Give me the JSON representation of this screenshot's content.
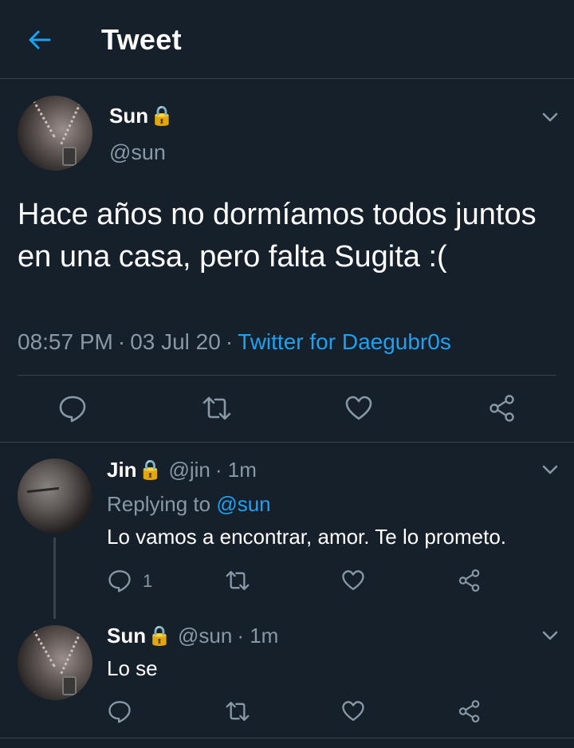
{
  "header": {
    "title": "Tweet"
  },
  "main_tweet": {
    "name": "Sun",
    "lock": "🔒",
    "handle": "@sun",
    "text": "Hace años no dormíamos todos juntos en una casa, pero falta Sugita :(",
    "time": "08:57 PM",
    "date": "03 Jul 20",
    "separator": "·",
    "source": "Twitter for Daegubr0s"
  },
  "replies": [
    {
      "name": "Jin",
      "lock": "🔒",
      "handle": "@jin",
      "time": "· 1m",
      "replying_label": "Replying to",
      "replying_to": "@sun",
      "text": "Lo vamos a encontrar, amor. Te lo prometo.",
      "reply_count": "1"
    },
    {
      "name": "Sun",
      "lock": "🔒",
      "handle": "@sun",
      "time": "· 1m",
      "text": "Lo se"
    }
  ],
  "icons": {
    "back": "arrow-left-icon",
    "caret": "chevron-down-icon",
    "reply": "comment-icon",
    "retweet": "retweet-icon",
    "like": "heart-icon",
    "share": "share-icon"
  },
  "colors": {
    "background": "#15202b",
    "accent": "#1da1f2",
    "secondary_text": "#8899a6",
    "border": "#38444d"
  }
}
